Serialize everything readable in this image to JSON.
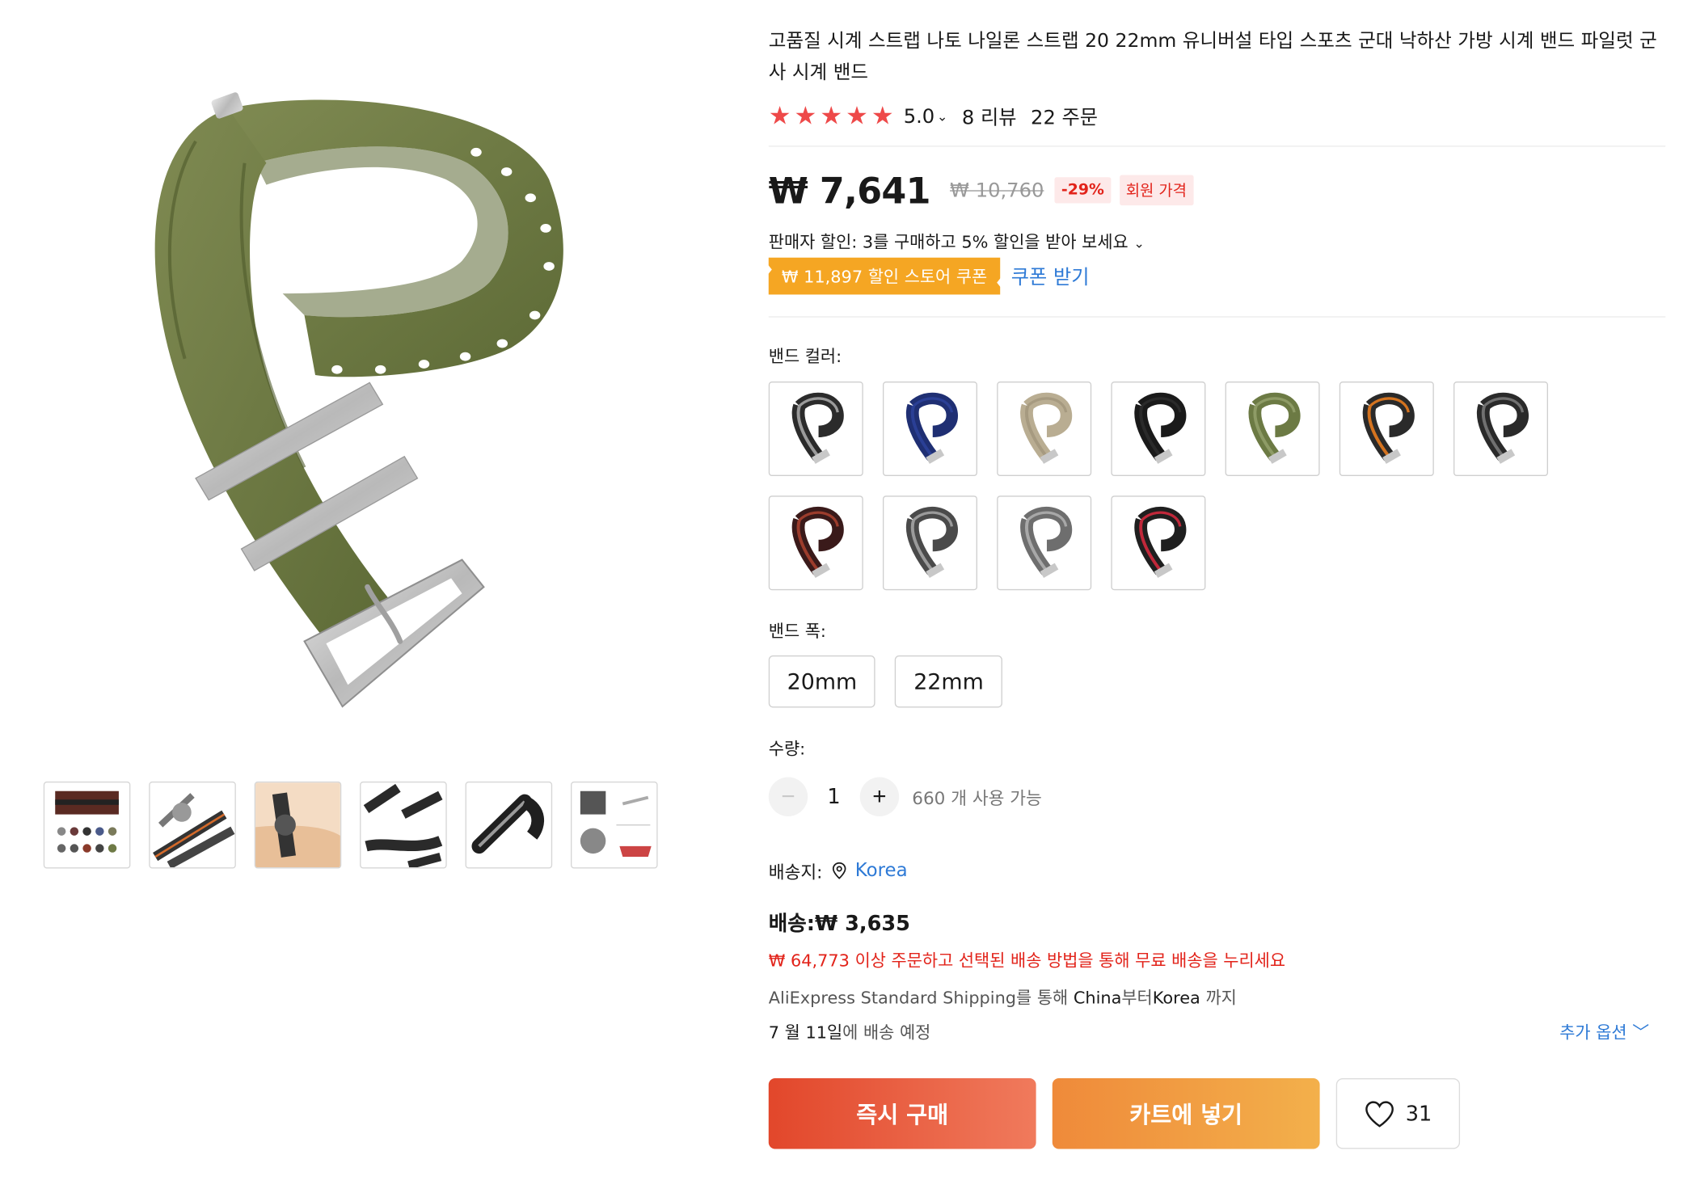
{
  "product": {
    "title": "고품질 시계 스트랩 나토 나일론 스트랩 20 22mm 유니버설 타입 스포츠 군대 낙하산 가방 시계 밴드 파일럿 군사 시계 밴드",
    "rating": "5.0",
    "rating_chevron": "⌄",
    "stars_shown": 5,
    "reviews": "8 리뷰",
    "orders": "22 주문"
  },
  "price": {
    "current": "₩ 7,641",
    "original": "₩ 10,760",
    "discount": "-29%",
    "member_badge": "회원 가격"
  },
  "promo": {
    "seller_discount": "판매자 할인: 3를 구매하고 5% 할인을 받아 보세요",
    "seller_discount_chevron": "⌄",
    "coupon": "₩ 11,897 할인 스토어 쿠폰",
    "coupon_link": "쿠폰 받기"
  },
  "options": {
    "color_label": "밴드 컬러:",
    "colors": [
      {
        "stripe": "#2b2b2b",
        "accent": "#9a9a9a"
      },
      {
        "stripe": "#1f2f73",
        "accent": "#2a3f95"
      },
      {
        "stripe": "#b9ad92",
        "accent": "#a69a80"
      },
      {
        "stripe": "#1a1a1a",
        "accent": "#2a2a2a"
      },
      {
        "stripe": "#6c7a44",
        "accent": "#8e9b66"
      },
      {
        "stripe": "#2a2a2a",
        "accent": "#d4731f"
      },
      {
        "stripe": "#2a2a2a",
        "accent": "#707070"
      },
      {
        "stripe": "#3a1a1a",
        "accent": "#9c3c2c"
      },
      {
        "stripe": "#4a4a4a",
        "accent": "#9a9a9a"
      },
      {
        "stripe": "#6e6e6e",
        "accent": "#a8a8a8"
      },
      {
        "stripe": "#1f1f1f",
        "accent": "#c0283a"
      }
    ],
    "width_label": "밴드 폭:",
    "widths": [
      "20mm",
      "22mm"
    ],
    "quantity_label": "수량:",
    "quantity": "1",
    "minus": "−",
    "plus": "+",
    "available": "660 개 사용 가능"
  },
  "shipping": {
    "ship_to_label": "배송지:",
    "ship_to": "Korea",
    "fee": "배송:₩ 3,635",
    "free_note": "₩ 64,773 이상 주문하고 선택된 배송 방법을 통해 무료 배송을 누리세요",
    "method_name": "AliExpress Standard Shipping",
    "method_via": "를 통해 ",
    "from": "China",
    "from_suffix": "부터",
    "to": "Korea",
    "to_suffix": " 까지",
    "date": "7 월 11일",
    "date_suffix": "에 배송 예정",
    "more_options": "추가 옵션"
  },
  "actions": {
    "buy_now": "즉시 구매",
    "add_to_cart": "카트에 넣기",
    "wishlist_count": "31"
  },
  "colors": {
    "accent_red": "#e2231a",
    "star": "#ee4949",
    "link_blue": "#2e7ad6",
    "coupon_orange": "#f5a623",
    "strap_olive": "#6e7a46"
  },
  "icons": {
    "star": "★",
    "chevron_down": "﹀"
  }
}
